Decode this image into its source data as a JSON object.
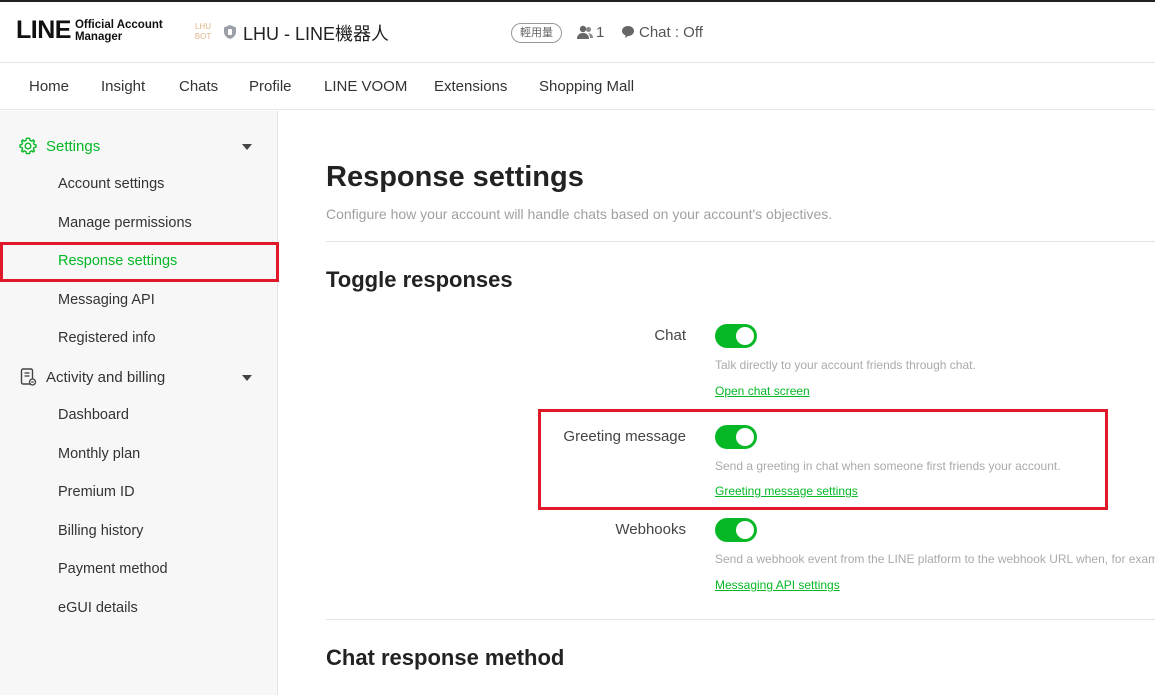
{
  "header": {
    "logo_main": "LINE",
    "logo_sub_1": "Official Account",
    "logo_sub_2": "Manager",
    "avatar_text_1": "LHU",
    "avatar_text_2": "BOT",
    "account_name": "LHU - LINE機器人",
    "plan_badge": "輕用量",
    "friends_count": "1",
    "chat_status": "Chat : Off"
  },
  "nav": {
    "items": [
      "Home",
      "Insight",
      "Chats",
      "Profile",
      "LINE VOOM",
      "Extensions",
      "Shopping Mall"
    ]
  },
  "sidebar": {
    "settings_label": "Settings",
    "settings_items": [
      "Account settings",
      "Manage permissions",
      "Response settings",
      "Messaging API",
      "Registered info"
    ],
    "activity_label": "Activity and billing",
    "activity_items": [
      "Dashboard",
      "Monthly plan",
      "Premium ID",
      "Billing history",
      "Payment method",
      "eGUI details"
    ]
  },
  "main": {
    "title": "Response settings",
    "description": "Configure how your account will handle chats based on your account's objectives.",
    "toggle_section": "Toggle responses",
    "rows": [
      {
        "label": "Chat",
        "desc": "Talk directly to your account friends through chat.",
        "link": "Open chat screen",
        "enabled": true
      },
      {
        "label": "Greeting message",
        "desc": "Send a greeting in chat when someone first friends your account.",
        "link": "Greeting message settings",
        "enabled": true
      },
      {
        "label": "Webhooks",
        "desc": "Send a webhook event from the LINE platform to the webhook URL when, for example, a user sends a message",
        "link": "Messaging API settings",
        "enabled": true
      }
    ],
    "method_section": "Chat response method"
  },
  "colors": {
    "accent_green": "#06b826",
    "highlight_red": "#e0192a"
  }
}
